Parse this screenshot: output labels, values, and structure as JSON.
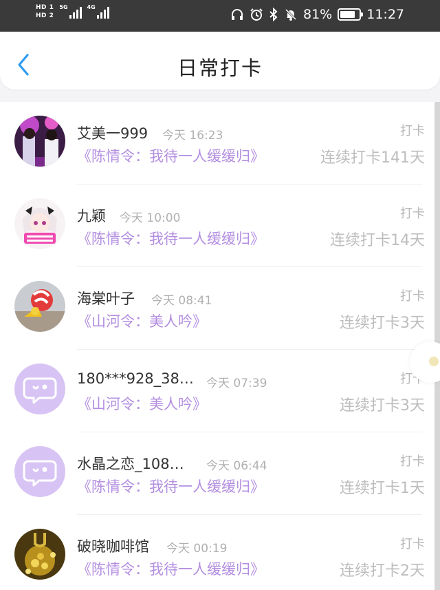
{
  "status_bar": {
    "sim1": "HD 1",
    "sim2": "HD 2",
    "net1": "5G",
    "net2": "4G",
    "battery": "81%",
    "battery_level": 0.81,
    "time": "11:27",
    "icons": [
      "headphones-icon",
      "alarm-icon",
      "bluetooth-icon",
      "mute-bell-icon",
      "battery-icon"
    ]
  },
  "header": {
    "back_icon": "chevron-left-icon",
    "title": "日常打卡",
    "accent": "#2e9cf0"
  },
  "colors": {
    "book": "#b38ee0",
    "default_avatar_bg": "#d8c4f4"
  },
  "records": [
    {
      "name": "艾美一999",
      "time": "今天 16:23",
      "action": "打卡",
      "book": "《陈情令：我待一人缓缓归》",
      "streak": "连续打卡141天",
      "avatar": "photo-avatar"
    },
    {
      "name": "九颖",
      "time": "今天 10:00",
      "action": "打卡",
      "book": "《陈情令：我待一人缓缓归》",
      "streak": "连续打卡14天",
      "avatar": "anime-avatar"
    },
    {
      "name": "海棠叶子",
      "time": "今天 08:41",
      "action": "打卡",
      "book": "《山河令：美人吟》",
      "streak": "连续打卡3天",
      "avatar": "bird-avatar"
    },
    {
      "name": "180***928_38…",
      "time": "今天 07:39",
      "action": "打卡",
      "book": "《山河令：美人吟》",
      "streak": "连续打卡3天",
      "avatar": "default-chat-avatar"
    },
    {
      "name": "水晶之恋_108…",
      "time": "今天 06:44",
      "action": "打卡",
      "book": "《陈情令：我待一人缓缓归》",
      "streak": "连续打卡1天",
      "avatar": "default-chat-avatar"
    },
    {
      "name": "破晓咖啡馆",
      "time": "今天 00:19",
      "action": "打卡",
      "book": "《陈情令：我待一人缓缓归》",
      "streak": "连续打卡2天",
      "avatar": "coffee-avatar"
    }
  ]
}
